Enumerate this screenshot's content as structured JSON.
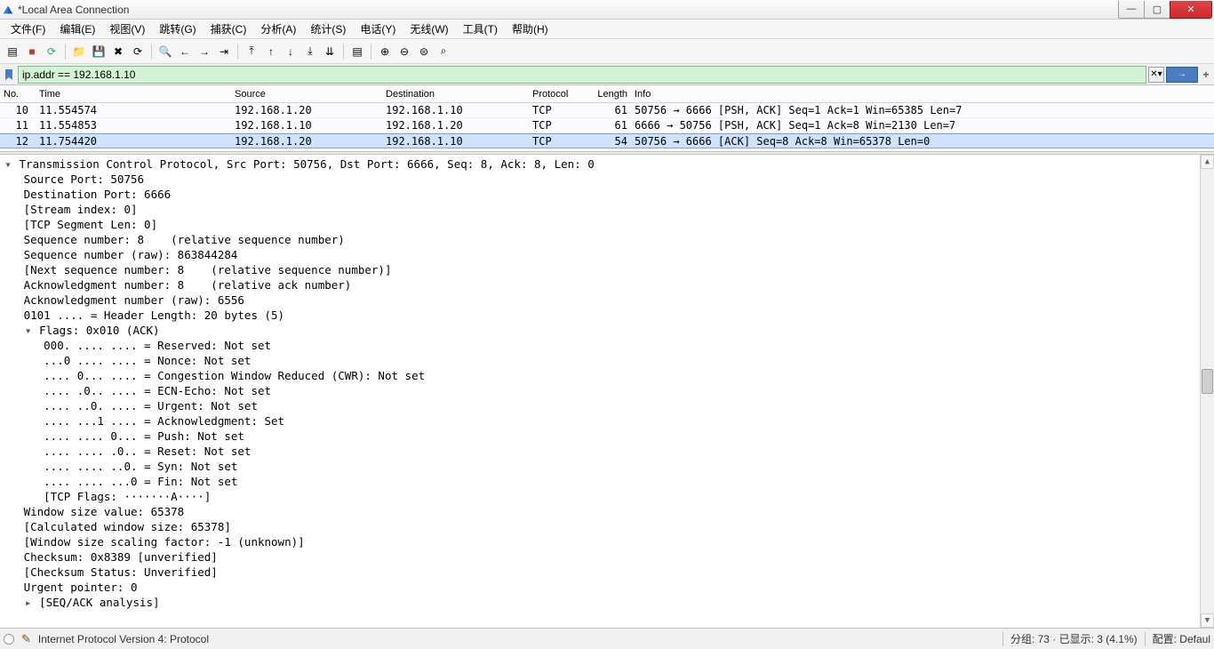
{
  "window": {
    "title": "*Local Area Connection"
  },
  "menu": [
    "文件(F)",
    "编辑(E)",
    "视图(V)",
    "跳转(G)",
    "捕获(C)",
    "分析(A)",
    "统计(S)",
    "电话(Y)",
    "无线(W)",
    "工具(T)",
    "帮助(H)"
  ],
  "filter": {
    "value": "ip.addr == 192.168.1.10"
  },
  "columns": {
    "no": "No.",
    "time": "Time",
    "src": "Source",
    "dst": "Destination",
    "proto": "Protocol",
    "len": "Length",
    "info": "Info"
  },
  "packets": [
    {
      "no": "10",
      "time": "11.554574",
      "src": "192.168.1.20",
      "dst": "192.168.1.10",
      "proto": "TCP",
      "len": "61",
      "info": "50756 → 6666 [PSH, ACK] Seq=1 Ack=1 Win=65385 Len=7",
      "sel": false
    },
    {
      "no": "11",
      "time": "11.554853",
      "src": "192.168.1.10",
      "dst": "192.168.1.20",
      "proto": "TCP",
      "len": "61",
      "info": "6666 → 50756 [PSH, ACK] Seq=1 Ack=8 Win=2130 Len=7",
      "sel": false
    },
    {
      "no": "12",
      "time": "11.754420",
      "src": "192.168.1.20",
      "dst": "192.168.1.10",
      "proto": "TCP",
      "len": "54",
      "info": "50756 → 6666 [ACK] Seq=8 Ack=8 Win=65378 Len=0",
      "sel": true
    }
  ],
  "details": {
    "header": "Transmission Control Protocol, Src Port: 50756, Dst Port: 6666, Seq: 8, Ack: 8, Len: 0",
    "lines": [
      {
        "i": 1,
        "t": "Source Port: 50756"
      },
      {
        "i": 1,
        "t": "Destination Port: 6666"
      },
      {
        "i": 1,
        "t": "[Stream index: 0]"
      },
      {
        "i": 1,
        "t": "[TCP Segment Len: 0]"
      },
      {
        "i": 1,
        "t": "Sequence number: 8    (relative sequence number)"
      },
      {
        "i": 1,
        "t": "Sequence number (raw): 863844284"
      },
      {
        "i": 1,
        "t": "[Next sequence number: 8    (relative sequence number)]"
      },
      {
        "i": 1,
        "t": "Acknowledgment number: 8    (relative ack number)"
      },
      {
        "i": 1,
        "t": "Acknowledgment number (raw): 6556"
      },
      {
        "i": 1,
        "t": "0101 .... = Header Length: 20 bytes (5)"
      },
      {
        "i": 1,
        "t": "Flags: 0x010 (ACK)",
        "tri": "▾"
      },
      {
        "i": 2,
        "t": "000. .... .... = Reserved: Not set"
      },
      {
        "i": 2,
        "t": "...0 .... .... = Nonce: Not set"
      },
      {
        "i": 2,
        "t": ".... 0... .... = Congestion Window Reduced (CWR): Not set"
      },
      {
        "i": 2,
        "t": ".... .0.. .... = ECN-Echo: Not set"
      },
      {
        "i": 2,
        "t": ".... ..0. .... = Urgent: Not set"
      },
      {
        "i": 2,
        "t": ".... ...1 .... = Acknowledgment: Set"
      },
      {
        "i": 2,
        "t": ".... .... 0... = Push: Not set"
      },
      {
        "i": 2,
        "t": ".... .... .0.. = Reset: Not set"
      },
      {
        "i": 2,
        "t": ".... .... ..0. = Syn: Not set"
      },
      {
        "i": 2,
        "t": ".... .... ...0 = Fin: Not set"
      },
      {
        "i": 2,
        "t": "[TCP Flags: ·······A····]"
      },
      {
        "i": 1,
        "t": "Window size value: 65378"
      },
      {
        "i": 1,
        "t": "[Calculated window size: 65378]"
      },
      {
        "i": 1,
        "t": "[Window size scaling factor: -1 (unknown)]"
      },
      {
        "i": 1,
        "t": "Checksum: 0x8389 [unverified]"
      },
      {
        "i": 1,
        "t": "[Checksum Status: Unverified]"
      },
      {
        "i": 1,
        "t": "Urgent pointer: 0"
      },
      {
        "i": 1,
        "t": "[SEQ/ACK analysis]",
        "tri": "▸"
      }
    ]
  },
  "status": {
    "field": "Internet Protocol Version 4: Protocol",
    "packets": "分组: 73 · 已显示: 3 (4.1%)",
    "profile": "配置: Defaul"
  },
  "toolbar_icons": [
    "list",
    "stop",
    "restart",
    "sep",
    "folder",
    "save",
    "close",
    "reload",
    "sep",
    "search",
    "back",
    "fwd",
    "jump",
    "sep",
    "first",
    "up",
    "down",
    "last",
    "autoscroll",
    "sep",
    "colorize",
    "sep",
    "zoom-in",
    "zoom-out",
    "zoom-reset",
    "zoom-fit"
  ]
}
